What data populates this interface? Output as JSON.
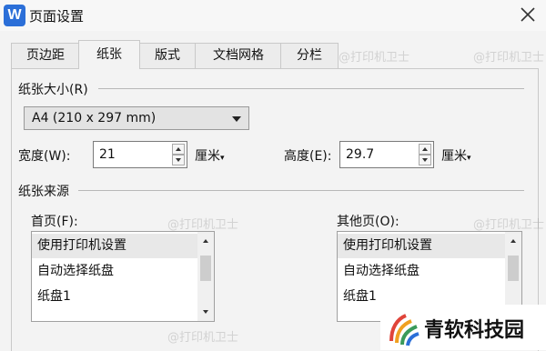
{
  "window": {
    "title": "页面设置",
    "app_icon": "W"
  },
  "tabs": [
    {
      "label": "页边距"
    },
    {
      "label": "纸张"
    },
    {
      "label": "版式"
    },
    {
      "label": "文档网格"
    },
    {
      "label": "分栏"
    }
  ],
  "paper_size": {
    "heading": "纸张大小(R)",
    "selected": "A4 (210 x 297 mm)",
    "width_label": "宽度(W):",
    "width_value": "21",
    "width_unit": "厘米",
    "height_label": "高度(E):",
    "height_value": "29.7",
    "height_unit": "厘米"
  },
  "paper_source": {
    "heading": "纸张来源",
    "first_page_label": "首页(F):",
    "other_pages_label": "其他页(O):",
    "first_page_items": [
      "使用打印机设置",
      "自动选择纸盘",
      "纸盘1"
    ],
    "other_pages_items": [
      "使用打印机设置",
      "自动选择纸盘",
      "纸盘1"
    ],
    "selected_index": 0
  },
  "watermark": "@打印机卫士",
  "brand_logo": "青软科技园",
  "colors": {
    "accent": "#2b6fd8",
    "background": "#f3f3f3"
  }
}
